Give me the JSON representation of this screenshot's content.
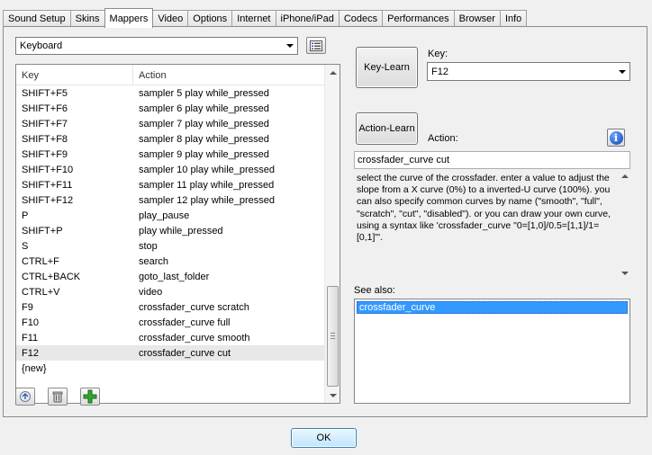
{
  "tabs": [
    {
      "label": "Sound Setup",
      "active": false
    },
    {
      "label": "Skins",
      "active": false
    },
    {
      "label": "Mappers",
      "active": true
    },
    {
      "label": "Video",
      "active": false
    },
    {
      "label": "Options",
      "active": false
    },
    {
      "label": "Internet",
      "active": false
    },
    {
      "label": "iPhone/iPad",
      "active": false
    },
    {
      "label": "Codecs",
      "active": false
    },
    {
      "label": "Performances",
      "active": false
    },
    {
      "label": "Browser",
      "active": false
    },
    {
      "label": "Info",
      "active": false
    }
  ],
  "mapper_select": {
    "value": "Keyboard",
    "icon": "list-view-icon"
  },
  "list": {
    "columns": [
      "Key",
      "Action"
    ],
    "rows": [
      {
        "key": "SHIFT+F5",
        "action": "sampler 5 play while_pressed"
      },
      {
        "key": "SHIFT+F6",
        "action": "sampler 6 play while_pressed"
      },
      {
        "key": "SHIFT+F7",
        "action": "sampler 7 play while_pressed"
      },
      {
        "key": "SHIFT+F8",
        "action": "sampler 8 play while_pressed"
      },
      {
        "key": "SHIFT+F9",
        "action": "sampler 9 play while_pressed"
      },
      {
        "key": "SHIFT+F10",
        "action": "sampler 10 play while_pressed"
      },
      {
        "key": "SHIFT+F11",
        "action": "sampler 11 play while_pressed"
      },
      {
        "key": "SHIFT+F12",
        "action": "sampler 12 play while_pressed"
      },
      {
        "key": "P",
        "action": "play_pause"
      },
      {
        "key": "SHIFT+P",
        "action": "play while_pressed"
      },
      {
        "key": "S",
        "action": "stop"
      },
      {
        "key": "CTRL+F",
        "action": "search"
      },
      {
        "key": "CTRL+BACK",
        "action": "goto_last_folder"
      },
      {
        "key": "CTRL+V",
        "action": "video"
      },
      {
        "key": "F9",
        "action": "crossfader_curve scratch"
      },
      {
        "key": "F10",
        "action": "crossfader_curve full"
      },
      {
        "key": "F11",
        "action": "crossfader_curve smooth"
      },
      {
        "key": "F12",
        "action": "crossfader_curve cut",
        "selected": true
      },
      {
        "key": "{new}",
        "action": ""
      }
    ]
  },
  "toolbar": {
    "icons": [
      "open-icon",
      "delete-icon",
      "add-icon"
    ]
  },
  "key_learn": {
    "button_label": "Key-Learn",
    "key_label": "Key:",
    "key_value": "F12"
  },
  "action_learn": {
    "button_label": "Action-Learn",
    "action_label": "Action:",
    "action_value": "crossfader_curve cut"
  },
  "description": "select the curve of the crossfader. enter a value to adjust the slope from a X curve (0%) to a inverted-U curve (100%). you can also specify common curves by name (\"smooth\", \"full\", \"scratch\", \"cut\", \"disabled\"). or you can draw your own curve, using a syntax like 'crossfader_curve \"0=[1,0]/0.5=[1,1]/1=[0,1]\"'.",
  "see_also": {
    "label": "See also:",
    "items": [
      "crossfader_curve"
    ]
  },
  "ok_label": "OK",
  "colors": {
    "selection": "#3399ff",
    "ok_button": "#bee6fd"
  }
}
